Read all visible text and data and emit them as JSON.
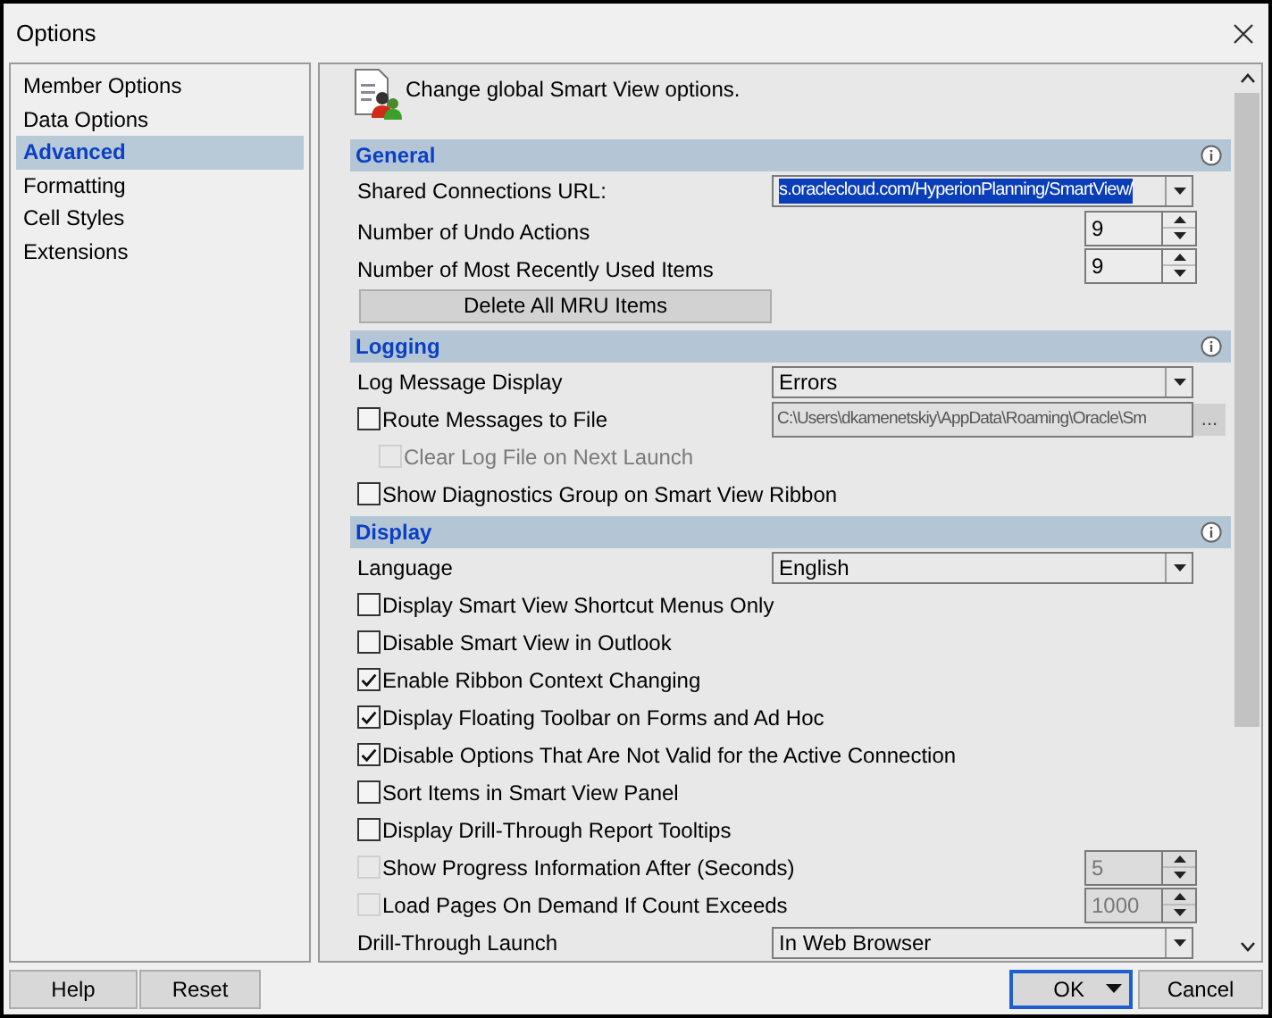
{
  "window": {
    "title": "Options"
  },
  "sidebar": {
    "items": [
      {
        "label": "Member Options",
        "selected": false
      },
      {
        "label": "Data Options",
        "selected": false
      },
      {
        "label": "Advanced",
        "selected": true
      },
      {
        "label": "Formatting",
        "selected": false
      },
      {
        "label": "Cell Styles",
        "selected": false
      },
      {
        "label": "Extensions",
        "selected": false
      }
    ]
  },
  "description": "Change global Smart View options.",
  "sections": [
    {
      "title": "General",
      "rows": [
        {
          "kind": "combo",
          "label": "Shared Connections URL:",
          "value": "s.oraclecloud.com/HyperionPlanning/SmartView/",
          "highlighted": true
        },
        {
          "kind": "spin",
          "label": "Number of Undo Actions",
          "value": "9",
          "disabled": false
        },
        {
          "kind": "spin",
          "label": "Number of Most Recently Used Items",
          "value": "9",
          "disabled": false
        },
        {
          "kind": "button",
          "label": "Delete All MRU Items"
        }
      ]
    },
    {
      "title": "Logging",
      "rows": [
        {
          "kind": "combo",
          "label": "Log Message Display",
          "value": "Errors",
          "highlighted": false
        },
        {
          "kind": "check_path",
          "label": "Route Messages to File",
          "checked": false,
          "value": "C:\\Users\\dkamenetskiy\\AppData\\Roaming\\Oracle\\Sm",
          "button": "...",
          "children": [
            {
              "kind": "check",
              "label": "Clear Log File on Next Launch",
              "checked": false,
              "disabled": true
            }
          ]
        },
        {
          "kind": "check",
          "label": "Show Diagnostics Group on Smart View Ribbon",
          "checked": false,
          "disabled": false
        }
      ]
    },
    {
      "title": "Display",
      "rows": [
        {
          "kind": "combo",
          "label": "Language",
          "value": "English",
          "highlighted": false
        },
        {
          "kind": "check",
          "label": "Display Smart View Shortcut Menus Only",
          "checked": false,
          "disabled": false
        },
        {
          "kind": "check",
          "label": "Disable Smart View in Outlook",
          "checked": false,
          "disabled": false
        },
        {
          "kind": "check",
          "label": "Enable Ribbon Context Changing",
          "checked": true,
          "disabled": false
        },
        {
          "kind": "check",
          "label": "Display Floating Toolbar on Forms and Ad Hoc",
          "checked": true,
          "disabled": false
        },
        {
          "kind": "check",
          "label": "Disable Options That Are Not Valid for the Active Connection",
          "checked": true,
          "disabled": false
        },
        {
          "kind": "check",
          "label": "Sort Items in Smart View Panel",
          "checked": false,
          "disabled": false
        },
        {
          "kind": "check",
          "label": "Display Drill-Through Report Tooltips",
          "checked": false,
          "disabled": false
        },
        {
          "kind": "check_spin",
          "label": "Show Progress Information After (Seconds)",
          "checked": false,
          "value": "5",
          "disabled": true
        },
        {
          "kind": "check_spin",
          "label": "Load Pages On Demand If Count Exceeds",
          "checked": false,
          "value": "1000",
          "disabled": true
        },
        {
          "kind": "combo",
          "label": "Drill-Through Launch",
          "value": "In Web Browser",
          "highlighted": false
        }
      ]
    }
  ],
  "footer": {
    "left_buttons": [
      "Help",
      "Reset"
    ],
    "ok": "OK",
    "cancel": "Cancel"
  }
}
